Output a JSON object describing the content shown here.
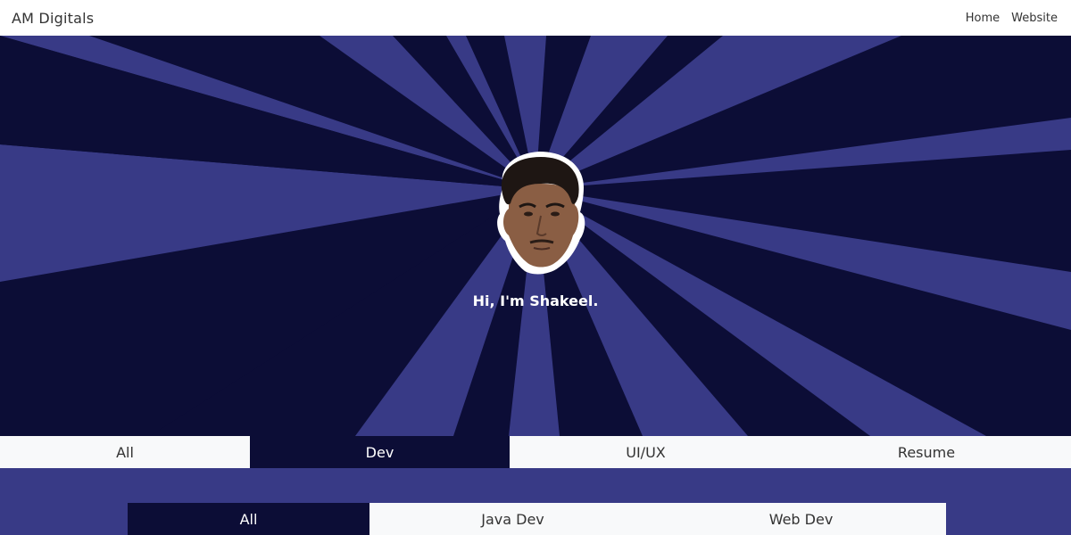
{
  "navbar": {
    "brand": "AM Digitals",
    "links": [
      "Home",
      "Website"
    ]
  },
  "hero": {
    "greeting": "Hi, I'm Shakeel.",
    "colors": {
      "light_ray": "#383a86",
      "dark_ray": "#0c0d36"
    },
    "avatar_icon": "profile-photo"
  },
  "main_tabs": [
    {
      "label": "All",
      "active": false
    },
    {
      "label": "Dev",
      "active": true
    },
    {
      "label": "UI/UX",
      "active": false
    },
    {
      "label": "Resume",
      "active": false
    }
  ],
  "sub_tabs": [
    {
      "label": "All",
      "active": true
    },
    {
      "label": "Java Dev",
      "active": false
    },
    {
      "label": "Web Dev",
      "active": false
    }
  ],
  "colors": {
    "accent_dark": "#0c0d36",
    "accent": "#383a86",
    "tab_bg": "#f8f9fa",
    "navbar_bg": "#ffffff"
  }
}
